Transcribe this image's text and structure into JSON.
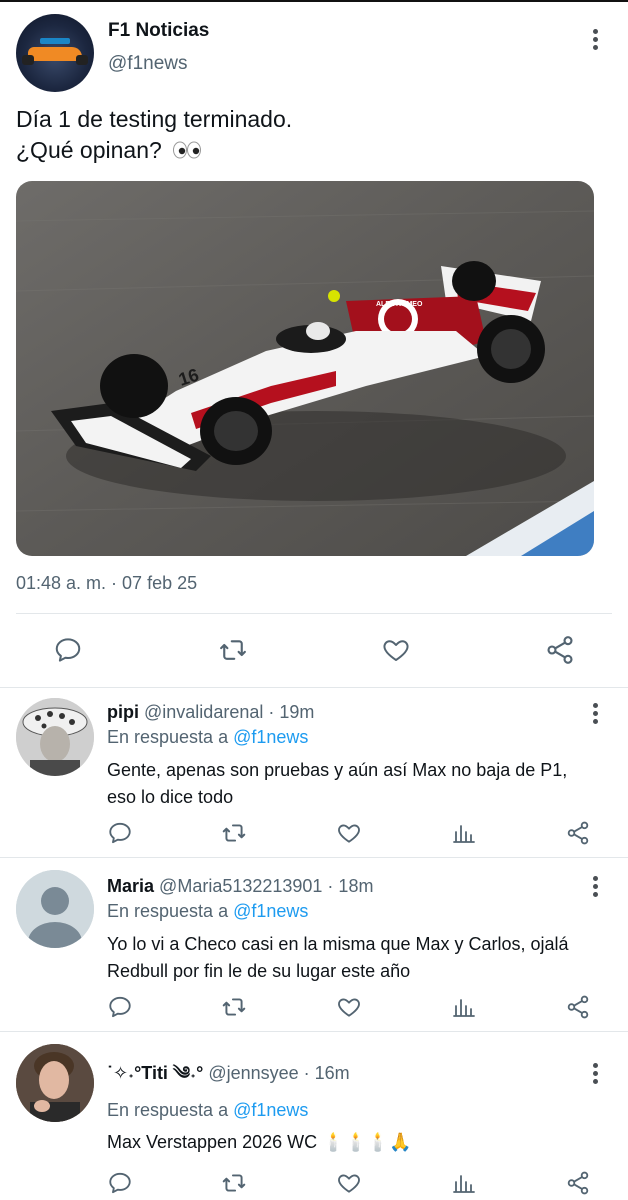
{
  "main_tweet": {
    "display_name": "F1 Noticias",
    "handle": "@f1news",
    "text_line1": "Día 1 de testing terminado.",
    "text_line2": "¿Qué opinan?",
    "emoji": "👀",
    "timestamp": "01:48 a. m. · 07 feb 25",
    "media_icon": "formula-1-car-photo",
    "car_sponsor_text": "ALFA ROMEO",
    "car_number": "16"
  },
  "actions": {
    "reply_icon": "reply-icon",
    "retweet_icon": "retweet-icon",
    "like_icon": "heart-icon",
    "share_icon": "share-icon",
    "analytics_icon": "analytics-icon"
  },
  "replies": [
    {
      "display_name": "pipi",
      "handle_time": "@invalidarenal · 19m",
      "in_reply_prefix": "En respuesta a ",
      "in_reply_mention": "@f1news",
      "text_line1": "Gente, apenas son pruebas y aún así Max no baja de P1,",
      "text_line2": "eso lo dice todo"
    },
    {
      "display_name": "Maria",
      "handle_time": "@Maria5132213901 · 18m",
      "in_reply_prefix": "En respuesta a ",
      "in_reply_mention": "@f1news",
      "text_line1": "Yo lo vi a Checo casi en la misma que Max y Carlos, ojalá",
      "text_line2": "Redbull por fin le de su lugar este año"
    },
    {
      "display_name": "˙✧˖°Titi ༄˖°",
      "handle_time": "@jennsyee · 16m",
      "in_reply_prefix": "En respuesta a ",
      "in_reply_mention": "@f1news",
      "text_line1": "Max Verstappen 2026 WC 🕯️🕯️🕯️🙏",
      "text_line2": ""
    }
  ],
  "colors": {
    "text": "#0f1419",
    "secondary": "#536471",
    "link": "#1d9bf0",
    "divider": "#e3e7ea",
    "icon": "#536471"
  }
}
